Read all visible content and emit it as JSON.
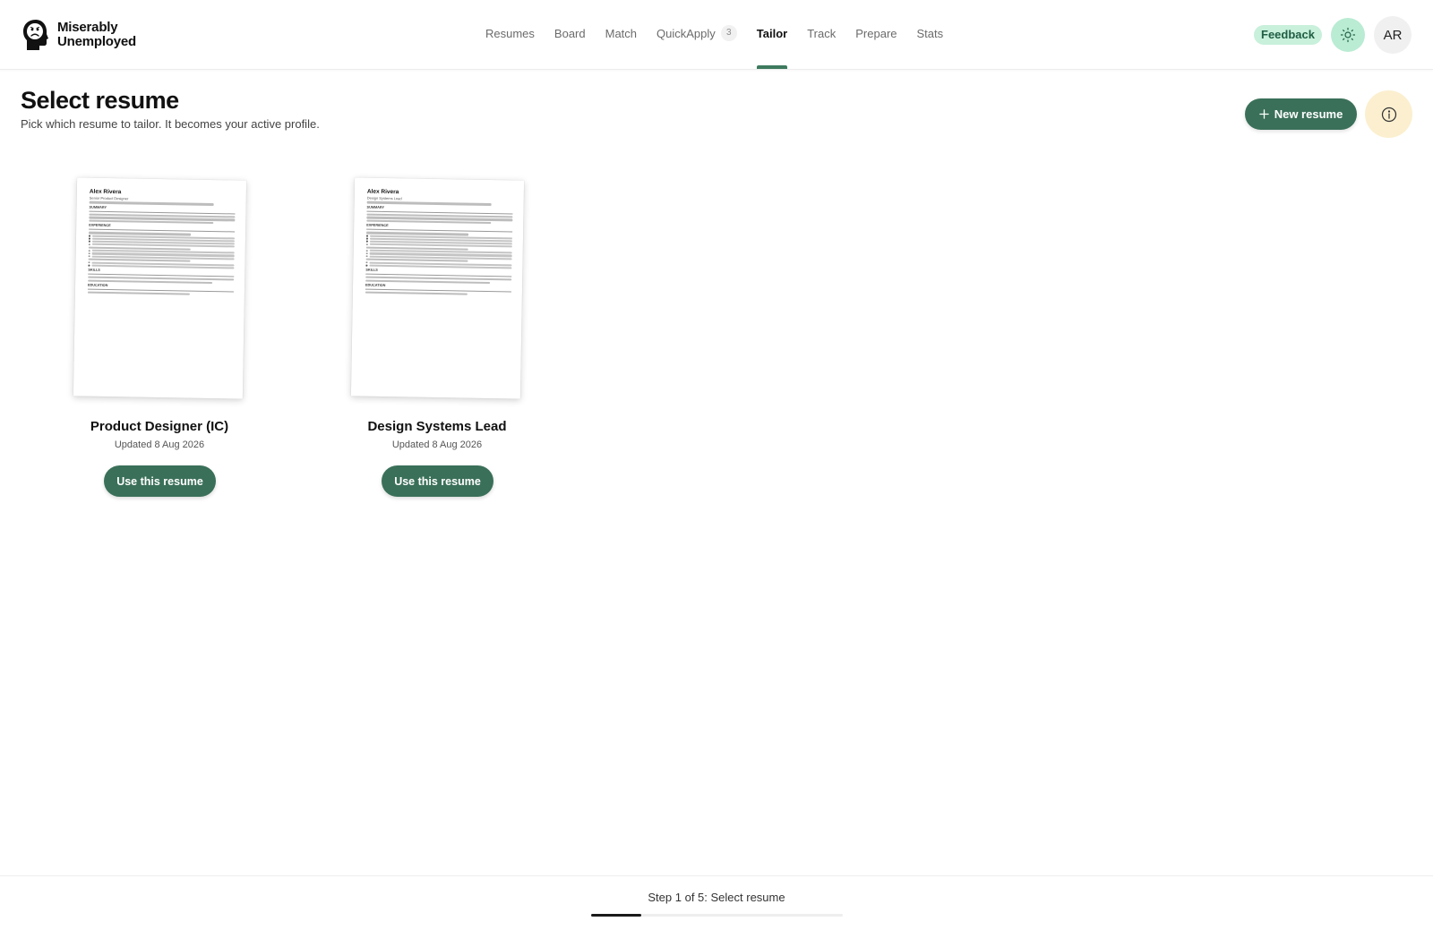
{
  "brand": {
    "name_line1": "Miserably",
    "name_line2": "Unemployed"
  },
  "nav": {
    "items": [
      {
        "label": "Resumes"
      },
      {
        "label": "Board"
      },
      {
        "label": "Match"
      },
      {
        "label": "QuickApply",
        "badge": "3"
      },
      {
        "label": "Tailor",
        "active": true
      },
      {
        "label": "Track"
      },
      {
        "label": "Prepare"
      },
      {
        "label": "Stats"
      }
    ]
  },
  "header": {
    "feedback_label": "Feedback",
    "theme_icon": "sun-icon",
    "avatar_initials": "AR"
  },
  "page": {
    "title": "Select resume",
    "subtitle": "Pick which resume to tailor. It becomes your active profile.",
    "new_resume_label": "New resume",
    "new_resume_icon": "plus-icon",
    "info_icon": "info-icon"
  },
  "resumes": [
    {
      "title": "Product Designer (IC)",
      "updated": "Updated 8 Aug 2026",
      "button_label": "Use this resume",
      "preview": {
        "name": "Alex Rivera",
        "role": "Senior Product Designer",
        "sections": [
          "SUMMARY",
          "EXPERIENCE",
          "SKILLS",
          "EDUCATION"
        ]
      }
    },
    {
      "title": "Design Systems Lead",
      "updated": "Updated 8 Aug 2026",
      "button_label": "Use this resume",
      "preview": {
        "name": "Alex Rivera",
        "role": "Design Systems Lead",
        "sections": [
          "SUMMARY",
          "EXPERIENCE",
          "SKILLS",
          "EDUCATION"
        ]
      }
    }
  ],
  "footer": {
    "step_label": "Step 1 of 5: Select resume",
    "progress": 0.2
  },
  "colors": {
    "accent": "#3a7059",
    "feedback_bg": "#c8f0db",
    "info_bg": "#fbefcf",
    "theme_bg": "#b9ecd3"
  }
}
